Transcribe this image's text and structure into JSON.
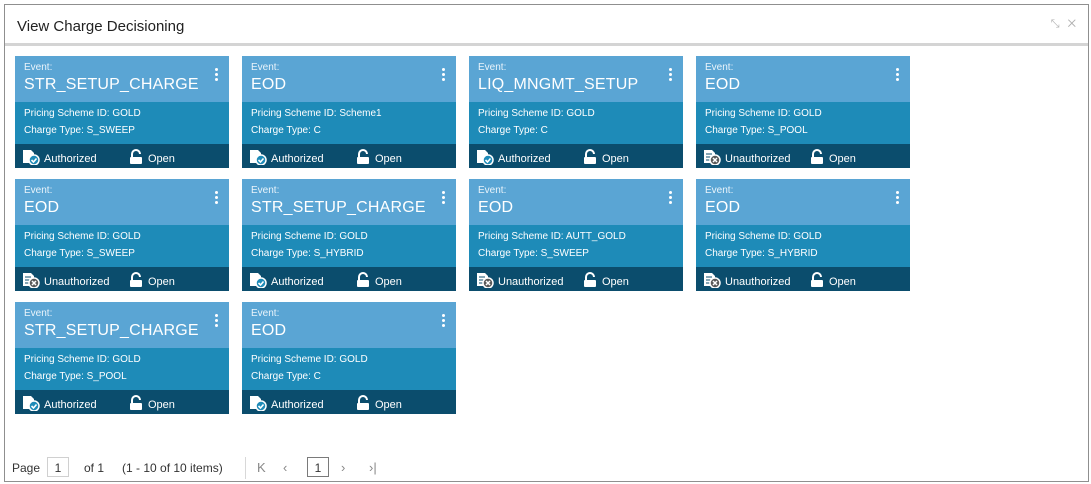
{
  "window": {
    "title": "View Charge Decisioning",
    "controls": [
      "minimize-icon",
      "close-icon"
    ]
  },
  "labels": {
    "event": "Event:",
    "pricing_prefix": "Pricing Scheme ID: ",
    "charge_prefix": "Charge Type: "
  },
  "cards": [
    {
      "event": "STR_SETUP_CHARGE",
      "pricing_text": "Pricing Scheme ID: GOLD",
      "charge_text": "Charge Type: S_SWEEP",
      "status": "Authorized",
      "state": "Open"
    },
    {
      "event": "EOD",
      "pricing_text": "Pricing Scheme ID: Scheme1",
      "charge_text": "Charge Type: C",
      "status": "Authorized",
      "state": "Open"
    },
    {
      "event": "LIQ_MNGMT_SETUP",
      "pricing_text": "Pricing Scheme ID: GOLD",
      "charge_text": "Charge Type: C",
      "status": "Authorized",
      "state": "Open"
    },
    {
      "event": "EOD",
      "pricing_text": "Pricing Scheme ID: GOLD",
      "charge_text": "Charge Type: S_POOL",
      "status": "Unauthorized",
      "state": "Open"
    },
    {
      "event": "EOD",
      "pricing_text": "Pricing Scheme ID: GOLD",
      "charge_text": "Charge Type: S_SWEEP",
      "status": "Unauthorized",
      "state": "Open"
    },
    {
      "event": "STR_SETUP_CHARGE",
      "pricing_text": "Pricing Scheme ID: GOLD",
      "charge_text": "Charge Type: S_HYBRID",
      "status": "Authorized",
      "state": "Open"
    },
    {
      "event": "EOD",
      "pricing_text": "Pricing Scheme ID: AUTT_GOLD",
      "charge_text": "Charge Type: S_SWEEP",
      "status": "Unauthorized",
      "state": "Open"
    },
    {
      "event": "EOD",
      "pricing_text": "Pricing Scheme ID: GOLD",
      "charge_text": "Charge Type: S_HYBRID",
      "status": "Unauthorized",
      "state": "Open"
    },
    {
      "event": "STR_SETUP_CHARGE",
      "pricing_text": "Pricing Scheme ID: GOLD",
      "charge_text": "Charge Type: S_POOL",
      "status": "Authorized",
      "state": "Open"
    },
    {
      "event": "EOD",
      "pricing_text": "Pricing Scheme ID: GOLD",
      "charge_text": "Charge Type: C",
      "status": "Authorized",
      "state": "Open"
    }
  ],
  "pagination": {
    "page_label": "Page",
    "page_input": "1",
    "of_text": "of 1",
    "items_text": "(1 - 10 of 10 items)",
    "current_page": "1",
    "first_icon": "first-page-icon",
    "prev_icon": "prev-page-icon",
    "next_icon": "next-page-icon",
    "last_icon": "last-page-icon"
  },
  "colors": {
    "card_header": "#5aa5d4",
    "card_body": "#1e8bb8",
    "card_footer": "#0b4d6d"
  }
}
